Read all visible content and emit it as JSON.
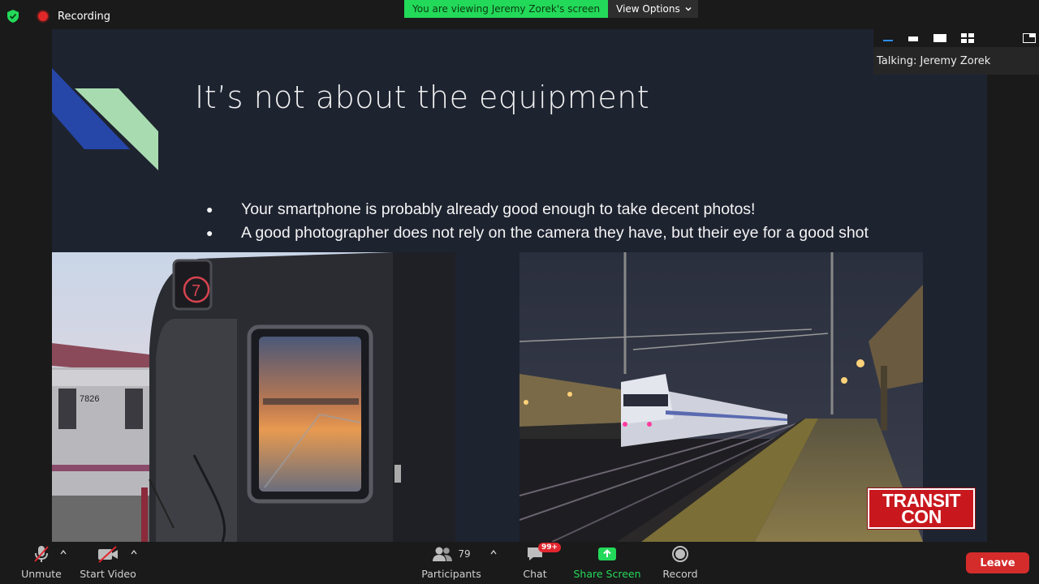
{
  "topbar": {
    "recording_label": "Recording",
    "viewing_banner": "You are viewing Jeremy Zorek's screen",
    "view_options_label": "View Options"
  },
  "slide": {
    "title": "It’s not about the equipment",
    "bullets": [
      "Your smartphone is probably already good enough to take decent photos!",
      "A good photographer does not rely on the camera they have, but their eye for a good shot"
    ],
    "logo_line1": "TRANSIT",
    "logo_line2": "CON",
    "train_number": "7826"
  },
  "side_panel": {
    "talking_label": "Talking: Jeremy Zorek"
  },
  "toolbar": {
    "unmute_label": "Unmute",
    "start_video_label": "Start Video",
    "participants_label": "Participants",
    "participants_count": "79",
    "chat_label": "Chat",
    "chat_badge": "99+",
    "share_screen_label": "Share Screen",
    "record_label": "Record",
    "leave_label": "Leave"
  },
  "colors": {
    "share_green": "#23d959",
    "leave_red": "#d42b2b",
    "slide_bg": "#1e2330",
    "recording_red": "#e02828"
  }
}
